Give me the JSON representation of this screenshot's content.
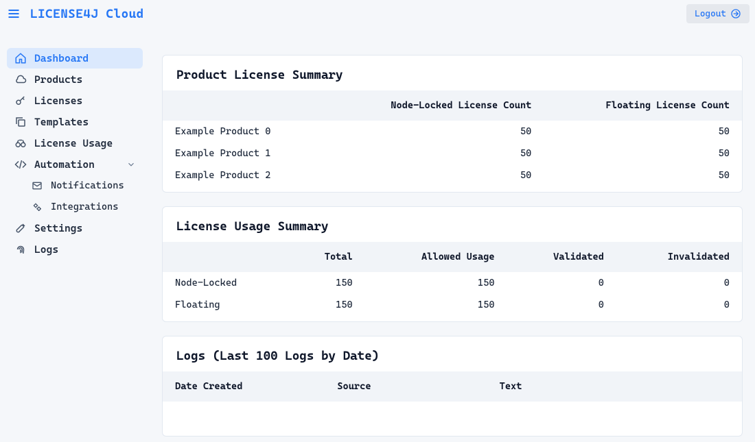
{
  "app": {
    "title": "LICENSE4J Cloud"
  },
  "header": {
    "logout": "Logout"
  },
  "sidebar": {
    "items": [
      {
        "label": "Dashboard",
        "icon": "home",
        "active": true
      },
      {
        "label": "Products",
        "icon": "cloud"
      },
      {
        "label": "Licenses",
        "icon": "key"
      },
      {
        "label": "Templates",
        "icon": "copy"
      },
      {
        "label": "License Usage",
        "icon": "binoculars"
      },
      {
        "label": "Automation",
        "icon": "code",
        "expandable": true,
        "children": [
          {
            "label": "Notifications",
            "icon": "mail"
          },
          {
            "label": "Integrations",
            "icon": "gears"
          }
        ]
      },
      {
        "label": "Settings",
        "icon": "wrench"
      },
      {
        "label": "Logs",
        "icon": "fingerprint"
      }
    ]
  },
  "cards": {
    "productSummary": {
      "title": "Product License Summary",
      "headers": [
        "",
        "Node-Locked License Count",
        "Floating License Count"
      ],
      "rows": [
        [
          "Example Product 0",
          "50",
          "50"
        ],
        [
          "Example Product 1",
          "50",
          "50"
        ],
        [
          "Example Product 2",
          "50",
          "50"
        ]
      ]
    },
    "usageSummary": {
      "title": "License Usage Summary",
      "headers": [
        "",
        "Total",
        "Allowed Usage",
        "Validated",
        "Invalidated"
      ],
      "rows": [
        [
          "Node-Locked",
          "150",
          "150",
          "0",
          "0"
        ],
        [
          "Floating",
          "150",
          "150",
          "0",
          "0"
        ]
      ]
    },
    "logs": {
      "title": "Logs (Last 100 Logs by Date)",
      "headers": [
        "Date Created",
        "Source",
        "Text"
      ],
      "rows": []
    }
  }
}
